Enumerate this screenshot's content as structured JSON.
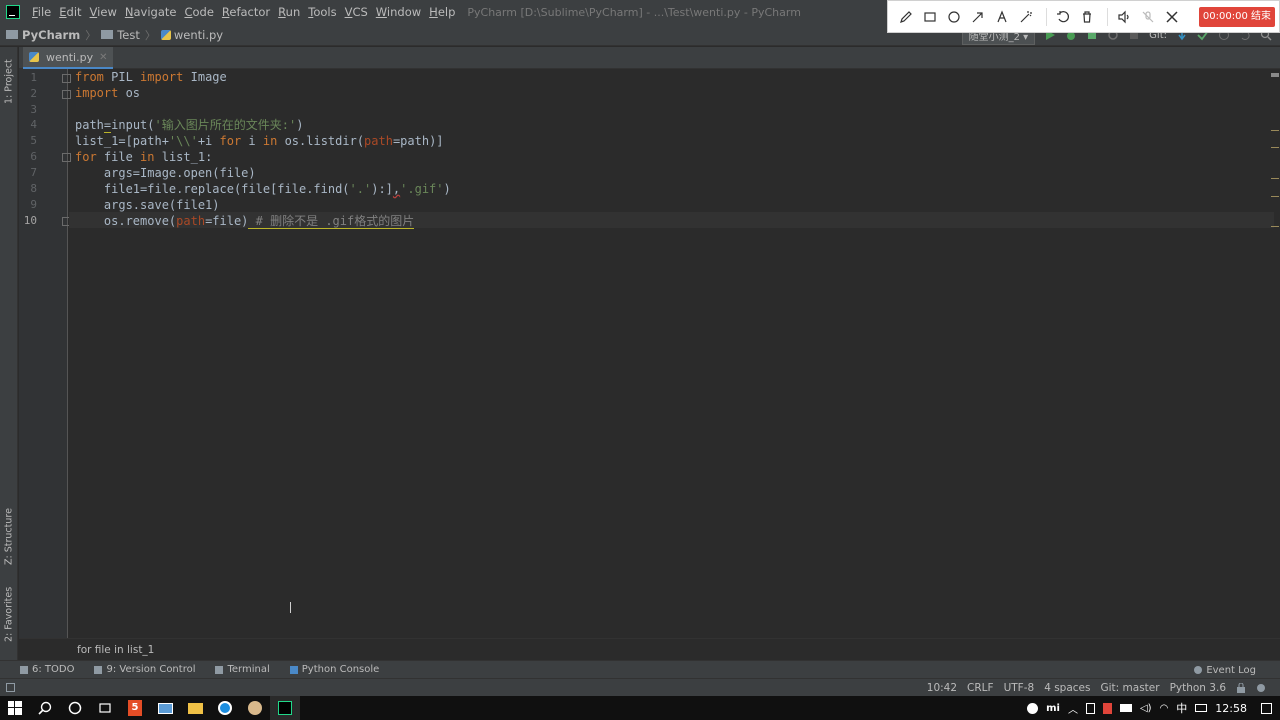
{
  "menubar": {
    "items": [
      {
        "u": "F",
        "rest": "ile"
      },
      {
        "u": "E",
        "rest": "dit"
      },
      {
        "u": "V",
        "rest": "iew"
      },
      {
        "u": "N",
        "rest": "avigate"
      },
      {
        "u": "C",
        "rest": "ode"
      },
      {
        "u": "R",
        "rest": "efactor"
      },
      {
        "u": "R",
        "rest": "un"
      },
      {
        "u": "T",
        "rest": "ools"
      },
      {
        "u": "V",
        "rest": "CS"
      },
      {
        "u": "W",
        "rest": "indow"
      },
      {
        "u": "H",
        "rest": "elp"
      }
    ],
    "window_title": "PyCharm [D:\\Sublime\\PyCharm] - ...\\Test\\wenti.py - PyCharm"
  },
  "recorder": {
    "timer": "00:00:00 结束",
    "icons": [
      "pencil-icon",
      "rectangle-icon",
      "ellipse-icon",
      "arrow-icon",
      "text-icon",
      "magic-wand-icon",
      "undo-icon",
      "trash-icon",
      "speaker-icon",
      "mic-off-icon",
      "close-icon"
    ]
  },
  "navbar": {
    "project": "PyCharm",
    "folder": "Test",
    "file": "wenti.py",
    "run_config": "随堂小测_2",
    "git_label": "Git:"
  },
  "left_strip": {
    "project_tab": "1: Project",
    "structure_tab": "Z: Structure",
    "favorites_tab": "2: Favorites"
  },
  "editor": {
    "tab": "wenti.py",
    "line_numbers": [
      "1",
      "2",
      "3",
      "4",
      "5",
      "6",
      "7",
      "8",
      "9",
      "10"
    ],
    "code": {
      "l1_kw1": "from",
      "l1_mid": " PIL ",
      "l1_kw2": "import",
      "l1_end": " Image",
      "l2_kw": "import",
      "l2_end": " os",
      "l4_a": "path",
      "l4_b": "=",
      "l4_c": "input(",
      "l4_str": "'输入图片所在的文件夹:'",
      "l4_d": ")",
      "l5_a": "list_1=[path+",
      "l5_str": "'\\\\'",
      "l5_b": "+i ",
      "l5_kw1": "for",
      "l5_c": " i ",
      "l5_kw2": "in",
      "l5_d": " os.listdir(",
      "l5_param": "path",
      "l5_e": "=path)]",
      "l6_kw1": "for",
      "l6_a": " file ",
      "l6_kw2": "in",
      "l6_b": " list_1:",
      "l7": "    args=Image.open(file)",
      "l8_a": "    file1=file.replace(file[file.find(",
      "l8_str1": "'.'",
      "l8_b": "):]",
      "l8_c": ",",
      "l8_str2": "'.gif'",
      "l8_d": ")",
      "l9": "    args.save(file1)",
      "l10_a": "    os.remove(",
      "l10_param": "path",
      "l10_b": "=file)",
      "l10_cmt": " # 删除不是 .gif格式的图片"
    }
  },
  "breadcrumb_bottom": "for file in list_1",
  "tool_tabs": {
    "todo": "6: TODO",
    "vcs": "9: Version Control",
    "terminal": "Terminal",
    "console": "Python Console",
    "event_log": "Event Log"
  },
  "status": {
    "position": "10:42",
    "line_sep": "CRLF",
    "encoding": "UTF-8",
    "indent": "4 spaces",
    "git": "Git: master",
    "interpreter": "Python 3.6"
  },
  "taskbar": {
    "ime": "中",
    "time": "12:58"
  }
}
